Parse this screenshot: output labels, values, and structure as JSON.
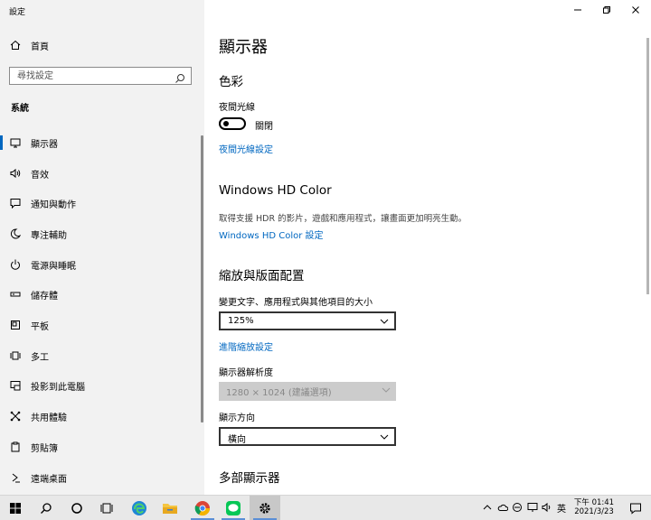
{
  "app": {
    "title": "設定"
  },
  "window_controls": {
    "minimize": "—",
    "restore": "❐",
    "close": "✕"
  },
  "sidebar": {
    "home_label": "首頁",
    "search_placeholder": "尋找設定",
    "section_label": "系統",
    "items": [
      {
        "label": "顯示器",
        "icon": "monitor-icon",
        "active": true
      },
      {
        "label": "音效",
        "icon": "speaker-icon"
      },
      {
        "label": "通知與動作",
        "icon": "notification-icon"
      },
      {
        "label": "專注輔助",
        "icon": "moon-icon"
      },
      {
        "label": "電源與睡眠",
        "icon": "power-icon"
      },
      {
        "label": "儲存體",
        "icon": "storage-icon"
      },
      {
        "label": "平板",
        "icon": "tablet-icon"
      },
      {
        "label": "多工",
        "icon": "multitask-icon"
      },
      {
        "label": "投影到此電腦",
        "icon": "project-icon"
      },
      {
        "label": "共用體驗",
        "icon": "shared-icon"
      },
      {
        "label": "剪貼簿",
        "icon": "clipboard-icon"
      },
      {
        "label": "遠端桌面",
        "icon": "remote-icon"
      }
    ]
  },
  "main": {
    "title": "顯示器",
    "color": {
      "heading": "色彩",
      "night_light_label": "夜間光線",
      "night_light_state": "關閉",
      "night_light_on": false,
      "night_light_link": "夜間光線設定"
    },
    "hdr": {
      "heading": "Windows HD Color",
      "description": "取得支援 HDR 的影片，遊戲和應用程式，讓畫面更加明亮生動。",
      "link": "Windows HD Color 設定"
    },
    "scale": {
      "heading": "縮放與版面配置",
      "size_label": "變更文字、應用程式與其他項目的大小",
      "size_value": "125%",
      "advanced_link": "進階縮放設定",
      "resolution_label": "顯示器解析度",
      "resolution_value": "1280 × 1024 (建議選項)",
      "orientation_label": "顯示方向",
      "orientation_value": "橫向"
    },
    "multi_heading": "多部顯示器"
  },
  "taskbar": {
    "ime": "英",
    "time": "下午 01:41",
    "date": "2021/3/23"
  },
  "colors": {
    "accent": "#0067c0",
    "sidebar_bg": "#f2f2f2",
    "taskbar_bg": "#e8e8e8"
  }
}
